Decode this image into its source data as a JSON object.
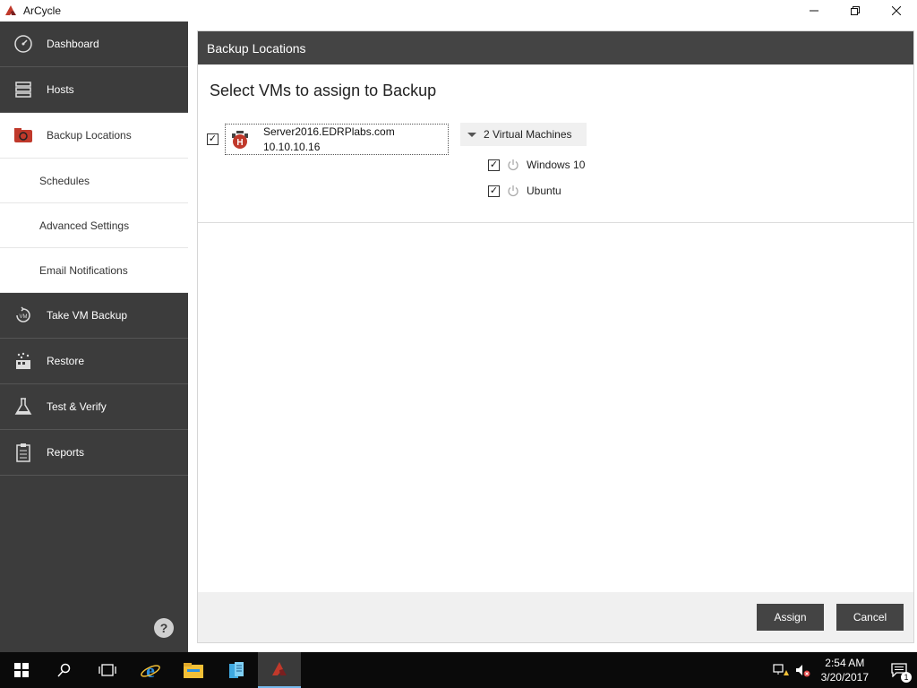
{
  "window": {
    "title": "ArCycle"
  },
  "sidebar": {
    "items": [
      {
        "label": "Dashboard",
        "icon": "dashboard-icon"
      },
      {
        "label": "Hosts",
        "icon": "hosts-icon"
      },
      {
        "label": "Backup Locations",
        "icon": "backup-locations-icon"
      },
      {
        "label": "Schedules"
      },
      {
        "label": "Advanced Settings"
      },
      {
        "label": "Email Notifications"
      },
      {
        "label": "Take VM Backup",
        "icon": "vm-backup-icon"
      },
      {
        "label": "Restore",
        "icon": "restore-icon"
      },
      {
        "label": "Test & Verify",
        "icon": "flask-icon"
      },
      {
        "label": "Reports",
        "icon": "clipboard-icon"
      }
    ],
    "help_label": "?"
  },
  "panel": {
    "header": "Backup Locations",
    "title": "Select VMs to assign to Backup",
    "host": {
      "name": "Server2016.EDRPlabs.com",
      "ip": "10.10.10.16",
      "checked": true
    },
    "vm_group": {
      "label": "2 Virtual Machines",
      "vms": [
        {
          "name": "Windows 10",
          "checked": true
        },
        {
          "name": "Ubuntu",
          "checked": true
        }
      ]
    },
    "buttons": {
      "assign": "Assign",
      "cancel": "Cancel"
    }
  },
  "taskbar": {
    "time": "2:54 AM",
    "date": "3/20/2017",
    "notification_count": "1"
  },
  "colors": {
    "sidebar_bg": "#3c3c3c",
    "header_bg": "#444444",
    "accent": "#c0392b"
  }
}
